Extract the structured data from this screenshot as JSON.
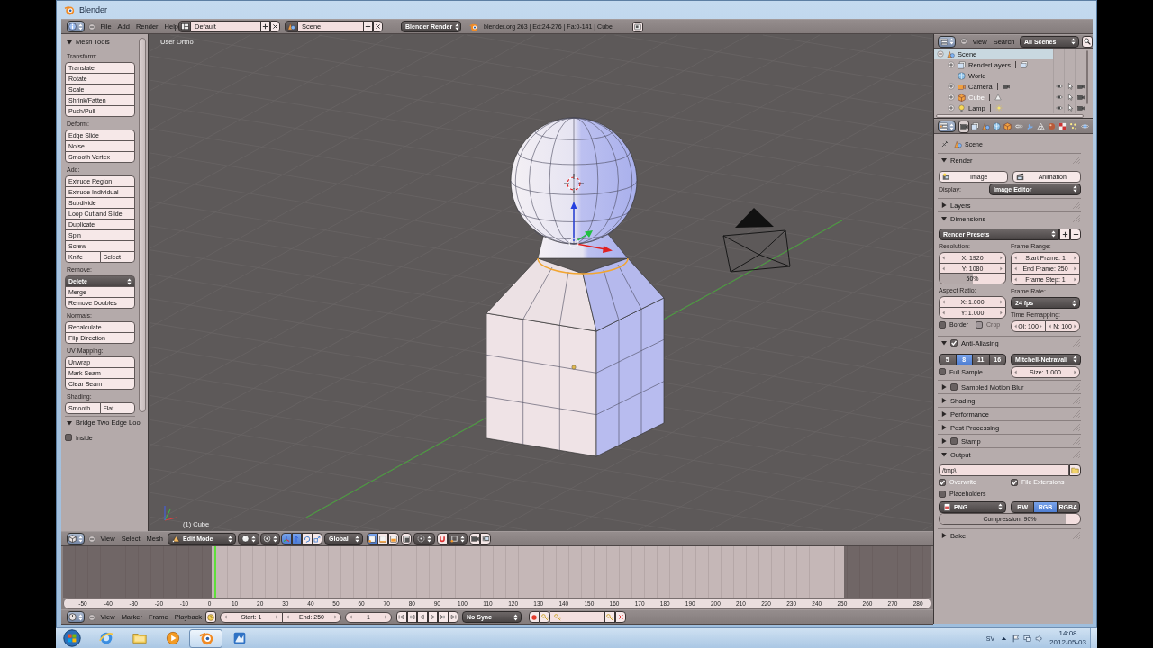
{
  "window": {
    "title": "Blender"
  },
  "info_header": {
    "menus": [
      "File",
      "Add",
      "Render",
      "Help"
    ],
    "layout": "Default",
    "scene": "Scene",
    "engine": "Blender Render",
    "stats": "blender.org 263 | Ed:24-276 | Fa:0-141 | Cube"
  },
  "tool_shelf": {
    "panels": [
      {
        "kind": "tools",
        "title": "Mesh Tools",
        "expanded": true,
        "groups": [
          {
            "label": "Transform:",
            "rows": [
              {
                "kind": "button",
                "buttons": [
                  "Translate"
                ]
              },
              {
                "kind": "button",
                "buttons": [
                  "Rotate"
                ]
              },
              {
                "kind": "button",
                "buttons": [
                  "Scale"
                ]
              },
              {
                "kind": "button",
                "buttons": [
                  "Shrink/Fatten"
                ]
              },
              {
                "kind": "button",
                "buttons": [
                  "Push/Pull"
                ]
              }
            ]
          },
          {
            "label": "Deform:",
            "rows": [
              {
                "kind": "button",
                "buttons": [
                  "Edge Slide"
                ]
              },
              {
                "kind": "button",
                "buttons": [
                  "Noise"
                ]
              },
              {
                "kind": "button",
                "buttons": [
                  "Smooth Vertex"
                ]
              }
            ]
          },
          {
            "label": "Add:",
            "rows": [
              {
                "kind": "button",
                "buttons": [
                  "Extrude Region"
                ]
              },
              {
                "kind": "button",
                "buttons": [
                  "Extrude Individual"
                ]
              },
              {
                "kind": "button",
                "buttons": [
                  "Subdivide"
                ]
              },
              {
                "kind": "button",
                "buttons": [
                  "Loop Cut and Slide"
                ]
              },
              {
                "kind": "button",
                "buttons": [
                  "Duplicate"
                ]
              },
              {
                "kind": "button",
                "buttons": [
                  "Spin"
                ]
              },
              {
                "kind": "button",
                "buttons": [
                  "Screw"
                ]
              },
              {
                "kind": "button",
                "buttons": [
                  "Knife",
                  "Select"
                ]
              }
            ]
          },
          {
            "label": "Remove:",
            "rows": [
              {
                "kind": "menu",
                "buttons": [
                  "Delete"
                ]
              },
              {
                "kind": "button",
                "buttons": [
                  "Merge"
                ]
              },
              {
                "kind": "button",
                "buttons": [
                  "Remove Doubles"
                ]
              }
            ]
          },
          {
            "label": "Normals:",
            "rows": [
              {
                "kind": "button",
                "buttons": [
                  "Recalculate"
                ]
              },
              {
                "kind": "button",
                "buttons": [
                  "Flip Direction"
                ]
              }
            ]
          },
          {
            "label": "UV Mapping:",
            "rows": [
              {
                "kind": "button",
                "buttons": [
                  "Unwrap"
                ]
              },
              {
                "kind": "button",
                "buttons": [
                  "Mark Seam"
                ]
              },
              {
                "kind": "button",
                "buttons": [
                  "Clear Seam"
                ]
              }
            ]
          },
          {
            "label": "Shading:",
            "rows": [
              {
                "kind": "button",
                "buttons": [
                  "Smooth",
                  "Flat"
                ]
              }
            ]
          }
        ]
      },
      {
        "kind": "options",
        "title": "Bridge Two Edge Loo",
        "expanded": true,
        "options": [
          {
            "label": "Inside",
            "checked": false
          }
        ]
      }
    ]
  },
  "viewport": {
    "view_label": "User Ortho",
    "object_label": "(1) Cube"
  },
  "viewport_header": {
    "menus": [
      "View",
      "Select",
      "Mesh"
    ],
    "mode": "Edit Mode",
    "orientation": "Global",
    "manipulators": [
      {
        "selected": true
      },
      {
        "selected": true
      },
      {
        "selected": false
      },
      {
        "selected": false
      }
    ],
    "select_modes": [
      {
        "selected": true
      },
      {
        "selected": false
      },
      {
        "selected": false
      }
    ]
  },
  "timeline": {
    "range_start": {
      "level": 0.171
    },
    "range_end": {
      "level": 0.899
    },
    "playhead": {
      "level": 0.174
    },
    "frames": [
      "-50",
      "-40",
      "-30",
      "-20",
      "-10",
      "0",
      "10",
      "20",
      "30",
      "40",
      "50",
      "60",
      "70",
      "80",
      "90",
      "100",
      "110",
      "120",
      "130",
      "140",
      "150",
      "160",
      "170",
      "180",
      "190",
      "200",
      "210",
      "220",
      "230",
      "240",
      "250",
      "260",
      "270",
      "280"
    ]
  },
  "timeline_header": {
    "menus": [
      "View",
      "Marker",
      "Frame",
      "Playback"
    ],
    "start": "Start: 1",
    "end": "End: 250",
    "current": "1",
    "sync": "No Sync"
  },
  "outliner": {
    "menus": [
      "View",
      "Search"
    ],
    "filter": "All Scenes",
    "tree": [
      {
        "label": "Scene",
        "selected": true,
        "active": false,
        "expanded": true,
        "children": [
          {
            "label": "RenderLayers",
            "selected": false,
            "active": false,
            "expanded": false
          },
          {
            "label": "World",
            "selected": false,
            "active": false
          },
          {
            "label": "Camera",
            "selected": false,
            "active": false,
            "expanded": false,
            "visible": true
          },
          {
            "label": "Cube",
            "selected": false,
            "active": true,
            "expanded": false,
            "visible": true
          },
          {
            "label": "Lamp",
            "selected": false,
            "active": false,
            "expanded": false,
            "visible": true
          }
        ]
      }
    ]
  },
  "properties": {
    "tabs": [
      {
        "selected": true
      },
      {
        "selected": false
      },
      {
        "selected": false
      },
      {
        "selected": false
      },
      {
        "selected": false
      },
      {
        "selected": false
      },
      {
        "selected": false
      },
      {
        "selected": false
      },
      {
        "selected": false
      },
      {
        "selected": false
      },
      {
        "selected": false
      },
      {
        "selected": false
      }
    ],
    "context": "Scene",
    "panels": [
      {
        "kind": "render",
        "title": "Render",
        "expanded": true,
        "buttons": [
          "Image",
          "Animation"
        ],
        "display_label": "Display:",
        "display": "Image Editor"
      },
      {
        "title": "Layers",
        "expanded": false
      },
      {
        "kind": "dimensions",
        "title": "Dimensions",
        "expanded": true,
        "presets": "Render Presets",
        "resolution_label": "Resolution:",
        "resolution_x": "X: 1920",
        "resolution_y": "Y: 1080",
        "percentage": {
          "text": "50%",
          "level": 0.5
        },
        "frame_range_label": "Frame Range:",
        "frame_start": "Start Frame: 1",
        "frame_end": "End Frame: 250",
        "frame_step": "Frame Step: 1",
        "aspect_label": "Aspect Ratio:",
        "aspect_x": "X: 1.000",
        "aspect_y": "Y: 1.000",
        "frame_rate_label": "Frame Rate:",
        "frame_rate": "24 fps",
        "options": [
          {
            "label": "Border",
            "checked": false,
            "disabled": false
          },
          {
            "label": "Crop",
            "checked": false,
            "disabled": true
          }
        ],
        "time_remapping_label": "Time Remapping:",
        "time_old": "Ol: 100",
        "time_new": "N: 100"
      },
      {
        "kind": "anti_aliasing",
        "title": "Anti-Aliasing",
        "expanded": true,
        "checked": true,
        "samples": [
          {
            "label": "5",
            "selected": false
          },
          {
            "label": "8",
            "selected": true
          },
          {
            "label": "11",
            "selected": false
          },
          {
            "label": "16",
            "selected": false
          }
        ],
        "filter": "Mitchell-Netravali",
        "full_sample": {
          "label": "Full Sample",
          "checked": false
        },
        "size": "Size: 1.000"
      },
      {
        "title": "Sampled Motion Blur",
        "expanded": false,
        "checked": false
      },
      {
        "title": "Shading",
        "expanded": false
      },
      {
        "title": "Performance",
        "expanded": false
      },
      {
        "title": "Post Processing",
        "expanded": false
      },
      {
        "title": "Stamp",
        "expanded": false,
        "checked": false
      },
      {
        "kind": "output",
        "title": "Output",
        "expanded": true,
        "path": "/tmp\\",
        "options": [
          {
            "label": "Overwrite",
            "checked": true
          },
          {
            "label": "File Extensions",
            "checked": true
          },
          {
            "label": "Placeholders",
            "checked": false
          }
        ],
        "format": "PNG",
        "color_modes": [
          {
            "label": "BW",
            "selected": false
          },
          {
            "label": "RGB",
            "selected": true
          },
          {
            "label": "RGBA",
            "selected": false
          }
        ],
        "compression": {
          "text": "Compression: 90%",
          "level": 0.9
        }
      },
      {
        "title": "Bake",
        "expanded": false
      }
    ]
  },
  "taskbar": {
    "apps": [
      {
        "selected": false
      },
      {
        "selected": false
      },
      {
        "selected": false
      },
      {
        "selected": true
      },
      {
        "selected": false
      }
    ],
    "language": "SV",
    "time": "14:08",
    "date": "2012-05-03"
  }
}
